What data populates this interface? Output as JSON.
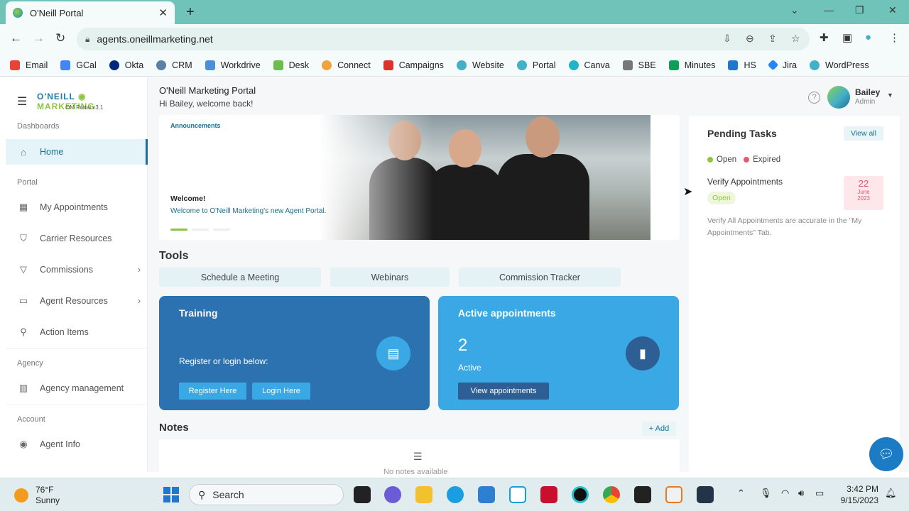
{
  "browser": {
    "tab_title": "O'Neill Portal",
    "url": "agents.oneillmarketing.net",
    "bookmarks": [
      "Email",
      "GCal",
      "Okta",
      "CRM",
      "Workdrive",
      "Desk",
      "Connect",
      "Campaigns",
      "Website",
      "Portal",
      "Canva",
      "SBE",
      "Minutes",
      "HS",
      "Jira",
      "WordPress"
    ]
  },
  "sidebar": {
    "logo_left": "O'NEILL",
    "logo_right": "MARKETING",
    "version": "OM Portal v3.1",
    "sections": {
      "dashboards": "Dashboards",
      "portal": "Portal",
      "agency": "Agency",
      "account": "Account"
    },
    "items": {
      "home": "Home",
      "appointments": "My Appointments",
      "carrier": "Carrier Resources",
      "commissions": "Commissions",
      "agent_resources": "Agent Resources",
      "action_items": "Action Items",
      "agency_mgmt": "Agency management",
      "agent_info": "Agent Info"
    }
  },
  "header": {
    "title": "O'Neill Marketing Portal",
    "greeting": "Hi Bailey, welcome back!",
    "user_name": "Bailey",
    "user_role": "Admin"
  },
  "banner": {
    "label": "Announcements",
    "heading": "Welcome!",
    "text": "Welcome to O'Neill Marketing's new Agent Portal."
  },
  "tools": {
    "title": "Tools",
    "buttons": [
      "Schedule a Meeting",
      "Webinars",
      "Commission Tracker"
    ]
  },
  "training": {
    "title": "Training",
    "text": "Register or login below:",
    "register": "Register Here",
    "login": "Login Here"
  },
  "appointments": {
    "title": "Active appointments",
    "count": "2",
    "label": "Active",
    "button": "View appointments"
  },
  "notes": {
    "title": "Notes",
    "add": "+ Add",
    "empty": "No notes available"
  },
  "pending": {
    "title": "Pending Tasks",
    "view_all": "View all",
    "legend_open": "Open",
    "legend_expired": "Expired",
    "task_title": "Verify Appointments",
    "task_status": "Open",
    "date_day": "22",
    "date_month": "June",
    "date_year": "2023",
    "task_desc": "Verify All Appointments are accurate in the \"My Appointments\" Tab."
  },
  "taskbar": {
    "temp": "76°F",
    "weather": "Sunny",
    "search": "Search",
    "time": "3:42 PM",
    "date": "9/15/2023"
  },
  "colors": {
    "accent": "#1b6f94",
    "green": "#8cc63f",
    "training_card": "#2d72b0",
    "appointments_card": "#3ba8e6"
  }
}
